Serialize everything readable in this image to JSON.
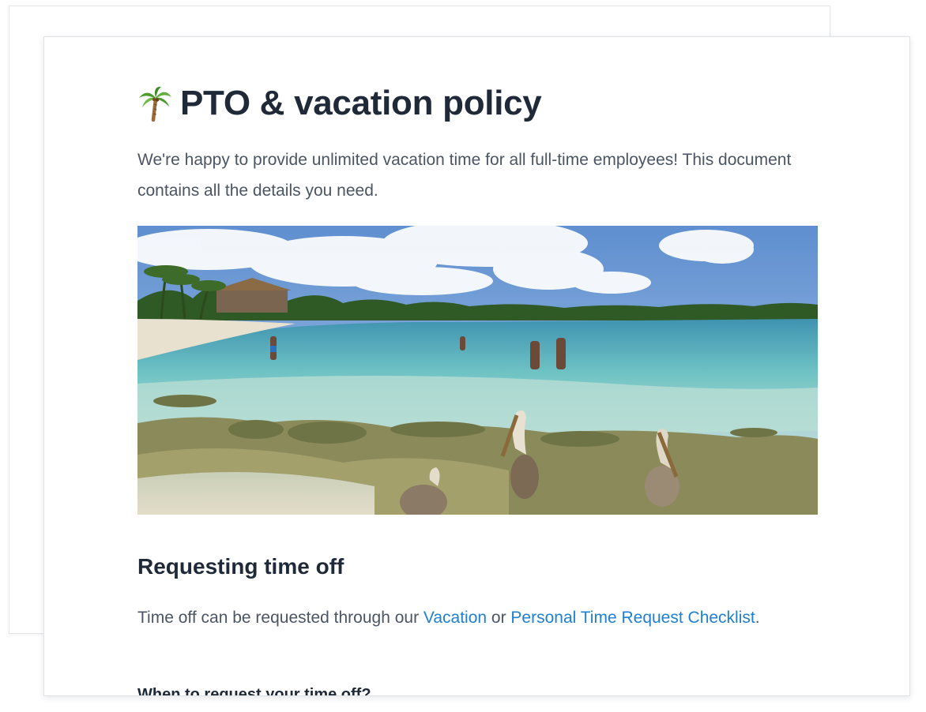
{
  "document": {
    "title": "PTO & vacation policy",
    "title_icon": "palm-tree-icon",
    "intro": "We're happy to provide unlimited vacation time for all full-time employees! This document contains all the details you need.",
    "hero_image": "beach-photo-with-pelicans",
    "sections": [
      {
        "heading": "Requesting time off",
        "text_before": "Time off can be requested through our ",
        "link_1": "Vacation",
        "text_middle": " or ",
        "link_2": "Personal Time Request Checklist",
        "text_after": ".",
        "subheading": "When to request your time off?"
      }
    ]
  },
  "colors": {
    "heading": "#1f2937",
    "body_text": "#4b5563",
    "link": "#1f7fd1",
    "card_border": "#dfe2e6"
  }
}
